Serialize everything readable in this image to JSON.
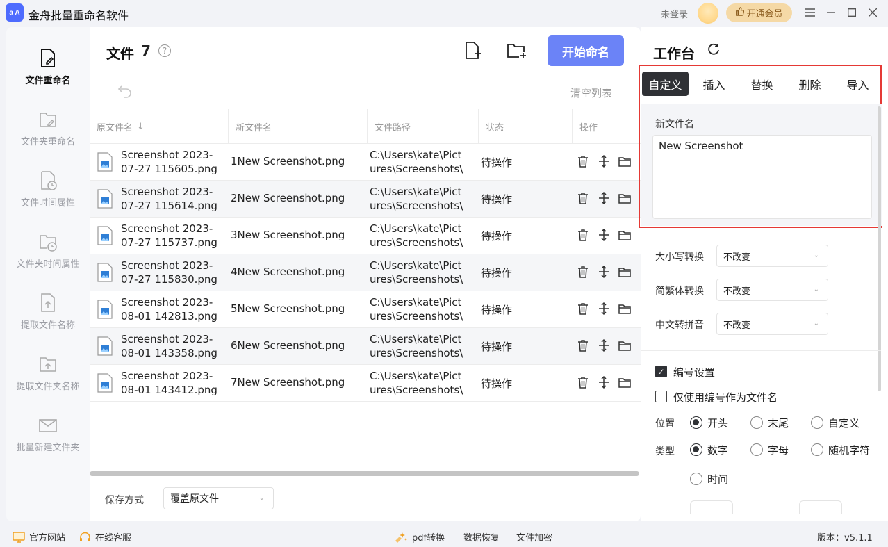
{
  "app": {
    "logo_text": "a A",
    "title": "金舟批量重命名软件",
    "login_text": "未登录",
    "vip_label": "开通会员"
  },
  "nav": [
    {
      "label": "文件重命名",
      "icon": "file-edit-icon",
      "active": true
    },
    {
      "label": "文件夹重命名",
      "icon": "folder-edit-icon",
      "active": false
    },
    {
      "label": "文件时间属性",
      "icon": "file-clock-icon",
      "active": false
    },
    {
      "label": "文件夹时间属性",
      "icon": "folder-clock-icon",
      "active": false
    },
    {
      "label": "提取文件名称",
      "icon": "file-upload-icon",
      "active": false
    },
    {
      "label": "提取文件夹名称",
      "icon": "folder-upload-icon",
      "active": false
    },
    {
      "label": "批量新建文件夹",
      "icon": "folder-new-icon",
      "active": false
    }
  ],
  "main": {
    "title": "文件",
    "count": "7",
    "start_label": "开始命名",
    "clear_label": "清空列表",
    "columns": [
      "原文件名",
      "新文件名",
      "文件路径",
      "状态",
      "操作"
    ],
    "rows": [
      {
        "orig1": "Screenshot 2023-",
        "orig2": "07-27 115605.png",
        "new": "1New Screenshot.png",
        "path1": "C:\\Users\\kate\\Pict",
        "path2": "ures\\Screenshots\\",
        "status": "待操作"
      },
      {
        "orig1": "Screenshot 2023-",
        "orig2": "07-27 115614.png",
        "new": "2New Screenshot.png",
        "path1": "C:\\Users\\kate\\Pict",
        "path2": "ures\\Screenshots\\",
        "status": "待操作"
      },
      {
        "orig1": "Screenshot 2023-",
        "orig2": "07-27 115737.png",
        "new": "3New Screenshot.png",
        "path1": "C:\\Users\\kate\\Pict",
        "path2": "ures\\Screenshots\\",
        "status": "待操作"
      },
      {
        "orig1": "Screenshot 2023-",
        "orig2": "07-27 115830.png",
        "new": "4New Screenshot.png",
        "path1": "C:\\Users\\kate\\Pict",
        "path2": "ures\\Screenshots\\",
        "status": "待操作"
      },
      {
        "orig1": "Screenshot 2023-",
        "orig2": "08-01 142813.png",
        "new": "5New Screenshot.png",
        "path1": "C:\\Users\\kate\\Pict",
        "path2": "ures\\Screenshots\\",
        "status": "待操作"
      },
      {
        "orig1": "Screenshot 2023-",
        "orig2": "08-01 143358.png",
        "new": "6New Screenshot.png",
        "path1": "C:\\Users\\kate\\Pict",
        "path2": "ures\\Screenshots\\",
        "status": "待操作"
      },
      {
        "orig1": "Screenshot 2023-",
        "orig2": "08-01 143412.png",
        "new": "7New Screenshot.png",
        "path1": "C:\\Users\\kate\\Pict",
        "path2": "ures\\Screenshots\\",
        "status": "待操作"
      }
    ],
    "save_label": "保存方式",
    "save_value": "覆盖原文件"
  },
  "panel": {
    "title": "工作台",
    "tabs": [
      "自定义",
      "插入",
      "替换",
      "删除",
      "导入"
    ],
    "active_tab": "自定义",
    "newname_label": "新文件名",
    "newname_value": "New Screenshot",
    "case_label": "大小写转换",
    "case_value": "不改变",
    "trad_label": "简繁体转换",
    "trad_value": "不改变",
    "pinyin_label": "中文转拼音",
    "pinyin_value": "不改变",
    "numbering_label": "编号设置",
    "numbering_checked": true,
    "only_number_label": "仅使用编号作为文件名",
    "only_number_checked": false,
    "position_label": "位置",
    "position_options": [
      "开头",
      "末尾",
      "自定义"
    ],
    "position_selected": "开头",
    "type_label": "类型",
    "type_options": [
      "数字",
      "字母",
      "随机字符",
      "时间"
    ],
    "type_selected": "数字"
  },
  "footer": {
    "website": "官方网站",
    "support": "在线客服",
    "pdf": "pdf转换",
    "recovery": "数据恢复",
    "encrypt": "文件加密",
    "version": "版本：v5.1.1"
  }
}
